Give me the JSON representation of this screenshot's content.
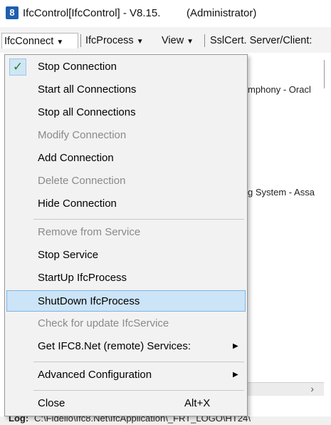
{
  "window": {
    "app_icon": "8",
    "title": "IfcControl[IfcControl] - V8.15.",
    "title_extra": "(Administrator)"
  },
  "menubar": {
    "items": [
      {
        "label": "IfcConnect"
      },
      {
        "label": "IfcProcess"
      },
      {
        "label": "View"
      },
      {
        "label": "SslCert. Server/Client:"
      }
    ]
  },
  "background": {
    "list_row_1": "mphony - Oracl",
    "list_row_2": "g System - Assa"
  },
  "statusbar": {
    "label": "Log:",
    "path": "C:\\Fidelio\\Ifc8.Net\\IfcApplication\\_FRT_LOGO\\HT24\\"
  },
  "dropdown": {
    "items": [
      {
        "label": "Stop Connection",
        "checked": true
      },
      {
        "label": "Start all Connections"
      },
      {
        "label": "Stop all Connections"
      },
      {
        "label": "Modify Connection",
        "disabled": true
      },
      {
        "label": "Add Connection"
      },
      {
        "label": "Delete Connection",
        "disabled": true
      },
      {
        "label": "Hide Connection"
      },
      {
        "label": "Remove from Service",
        "disabled": true
      },
      {
        "label": "Stop Service"
      },
      {
        "label": "StartUp IfcProcess"
      },
      {
        "label": "ShutDown IfcProcess",
        "highlighted": true
      },
      {
        "label": "Check for update IfcService",
        "disabled": true
      },
      {
        "label": "Get IFC8.Net (remote) Services:",
        "submenu": true
      },
      {
        "label": "Advanced Configuration",
        "submenu": true
      },
      {
        "label": "Close",
        "shortcut": "Alt+X"
      }
    ]
  },
  "icons": {
    "checkmark": "checkmark-icon",
    "submenu_arrow": "submenu-arrow-icon",
    "dropdown_caret": "chevron-down-icon"
  },
  "colors": {
    "highlight_bg": "#cce4f7",
    "highlight_border": "#7eb4e3",
    "disabled_text": "#8a8a8a",
    "app_icon_bg": "#1f5fae"
  }
}
